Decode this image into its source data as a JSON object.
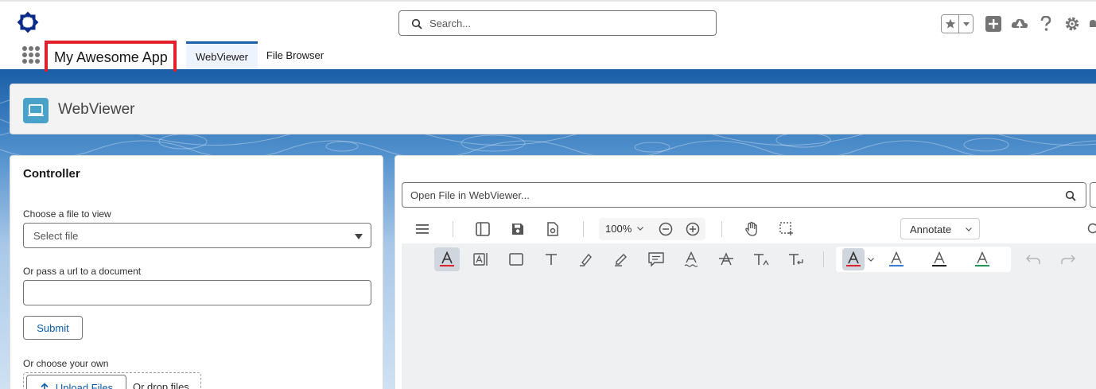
{
  "header": {
    "search_placeholder": "Search..."
  },
  "nav": {
    "app_name": "My Awesome App",
    "tabs": [
      {
        "label": "WebViewer",
        "active": true
      },
      {
        "label": "File Browser",
        "active": false
      }
    ]
  },
  "page": {
    "title": "WebViewer"
  },
  "controller": {
    "title": "Controller",
    "file_label": "Choose a file to view",
    "file_select_value": "Select file",
    "url_label": "Or pass a url to a document",
    "url_value": "",
    "submit_label": "Submit",
    "own_label": "Or choose your own",
    "upload_label": "Upload Files",
    "drop_label": "Or drop files"
  },
  "viewer": {
    "open_placeholder": "Open File in WebViewer...",
    "zoom": "100%",
    "mode": "Annotate"
  },
  "colors": {
    "brand": "#1b5fa8",
    "link": "#0b5cab",
    "highlight_border": "#e0202a",
    "underline_red": "#e0202a",
    "underline_blue": "#3b7bd4",
    "underline_black": "#222222",
    "underline_green": "#1f9d55"
  },
  "icons": {
    "logo": "square-diamond-logo",
    "search": "magnifier-icon",
    "favorite": "star-icon",
    "new": "plus-square-icon",
    "trailhead": "cloud-tree-icon",
    "help": "question-icon",
    "settings": "gear-icon"
  }
}
